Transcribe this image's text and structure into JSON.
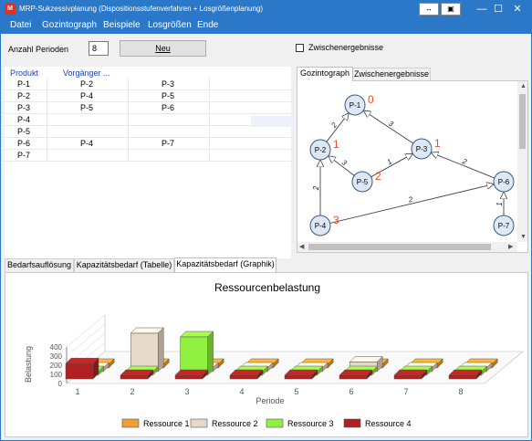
{
  "window": {
    "title": "MRP-Sukzessivplanung (Dispositionsstufenverfahren + Losgrößenplanung)",
    "controls": {
      "minimize": "—",
      "maximize": "☐",
      "close": "✕"
    },
    "extra_buttons": {
      "move": "↔",
      "save": "▣"
    }
  },
  "menu": {
    "items": [
      "Datei",
      "Gozintograph",
      "Beispiele",
      "Losgrößen",
      "Ende"
    ]
  },
  "periods": {
    "label": "Anzahl Perioden",
    "value": "8"
  },
  "neu_button": {
    "label": "Neu"
  },
  "zwischen_checkbox": {
    "label": "Zwischenergebnisse",
    "checked": false
  },
  "product_table": {
    "headers": [
      "Produkt",
      "Vorgänger ..."
    ],
    "rows": [
      [
        "P-1",
        "P-2",
        "P-3"
      ],
      [
        "P-2",
        "P-4",
        "P-5"
      ],
      [
        "P-3",
        "P-5",
        "P-6"
      ],
      [
        "P-4",
        "",
        ""
      ],
      [
        "P-5",
        "",
        ""
      ],
      [
        "P-6",
        "P-4",
        "P-7"
      ],
      [
        "P-7",
        "",
        ""
      ]
    ]
  },
  "graph_tabs": [
    "Gozintograph",
    "Zwischenergebnisse"
  ],
  "gozintograph": {
    "nodes": [
      {
        "id": "P-1",
        "level": "0"
      },
      {
        "id": "P-2",
        "level": "1"
      },
      {
        "id": "P-3",
        "level": "1"
      },
      {
        "id": "P-5",
        "level": "2"
      },
      {
        "id": "P-6",
        "level": ""
      },
      {
        "id": "P-4",
        "level": "3"
      },
      {
        "id": "P-7",
        "level": ""
      }
    ],
    "edges": [
      {
        "from": "P-2",
        "to": "P-1",
        "qty": "2"
      },
      {
        "from": "P-3",
        "to": "P-1",
        "qty": "3"
      },
      {
        "from": "P-5",
        "to": "P-2",
        "qty": "3"
      },
      {
        "from": "P-4",
        "to": "P-2",
        "qty": "2"
      },
      {
        "from": "P-5",
        "to": "P-3",
        "qty": "1"
      },
      {
        "from": "P-6",
        "to": "P-3",
        "qty": "2"
      },
      {
        "from": "P-4",
        "to": "P-6",
        "qty": "2"
      },
      {
        "from": "P-7",
        "to": "P-6",
        "qty": "1"
      }
    ],
    "level_color": "#e8501e"
  },
  "bottom_tabs": [
    "Bedarfsauflösung",
    "Kapazitätsbedarf (Tabelle)",
    "Kapazitätsbedarf (Graphik)"
  ],
  "chart_data": {
    "type": "bar",
    "title": "Ressourcenbelastung",
    "xlabel": "Periode",
    "ylabel": "Belastung",
    "categories": [
      "1",
      "2",
      "3",
      "4",
      "5",
      "6",
      "7",
      "8"
    ],
    "yticks": [
      "0",
      "100",
      "200",
      "300",
      "400"
    ],
    "ylim": [
      0,
      400
    ],
    "series": [
      {
        "name": "Ressource 1",
        "color": "#f0a030",
        "values": [
          0,
          0,
          0,
          0,
          20,
          0,
          10,
          0
        ]
      },
      {
        "name": "Ressource 2",
        "color": "#e8d8c8",
        "values": [
          0,
          400,
          0,
          0,
          0,
          100,
          0,
          0
        ]
      },
      {
        "name": "Ressource 3",
        "color": "#90f040",
        "values": [
          0,
          0,
          400,
          0,
          0,
          0,
          0,
          0
        ]
      },
      {
        "name": "Ressource 4",
        "color": "#b02020",
        "values": [
          160,
          0,
          0,
          0,
          0,
          0,
          0,
          0
        ]
      }
    ],
    "legend_position": "bottom"
  }
}
